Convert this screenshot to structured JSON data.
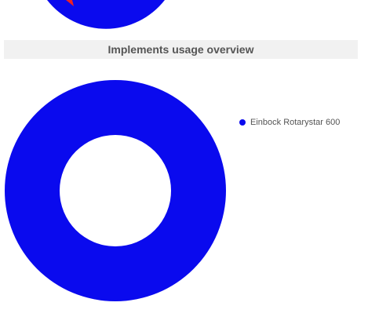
{
  "top_chart": {
    "type": "donut",
    "colors": [
      "#0a0aee",
      "#ee2222"
    ],
    "partial_view": true
  },
  "panel": {
    "title": "Implements usage overview"
  },
  "chart_data": {
    "type": "pie",
    "variant": "donut",
    "title": "Implements usage overview",
    "categories": [
      "Einbock Rotarystar 600"
    ],
    "values": [
      100
    ],
    "colors": [
      "#0a0aee"
    ],
    "legend_position": "right"
  },
  "legend": {
    "items": [
      {
        "label": "Einbock Rotarystar 600",
        "color": "#0a0aee"
      }
    ]
  }
}
